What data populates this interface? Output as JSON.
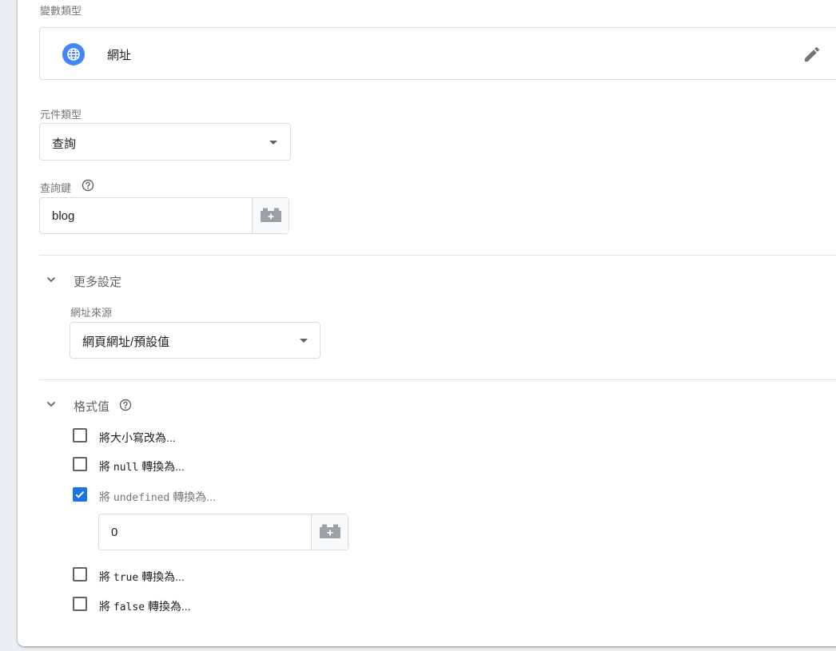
{
  "variable_type": {
    "section_label": "變數類型",
    "selected_name": "網址",
    "type_icon": "globe-icon",
    "edit_icon": "pencil-icon"
  },
  "component_type": {
    "label": "元件類型",
    "selected": "查詢"
  },
  "query_key": {
    "label": "查詢鍵",
    "value": "blog",
    "variable_icon": "lego-block-plus-icon"
  },
  "more_settings": {
    "title": "更多設定",
    "url_source_label": "網址來源",
    "url_source_selected": "網頁網址/預設值"
  },
  "format_value": {
    "title": "格式值",
    "options": [
      {
        "prefix": "將大小寫改為...",
        "code": "",
        "suffix": "",
        "checked": false
      },
      {
        "prefix": "將",
        "code": "null",
        "suffix": "轉換為...",
        "checked": false
      },
      {
        "prefix": "將",
        "code": "undefined",
        "suffix": "轉換為...",
        "checked": true
      },
      {
        "prefix": "將",
        "code": "true",
        "suffix": "轉換為...",
        "checked": false
      },
      {
        "prefix": "將",
        "code": "false",
        "suffix": "轉換為...",
        "checked": false
      }
    ],
    "undefined_value": "0"
  },
  "colors": {
    "accent": "#1a73e8",
    "border": "#dadce0",
    "muted_text": "#757575"
  }
}
